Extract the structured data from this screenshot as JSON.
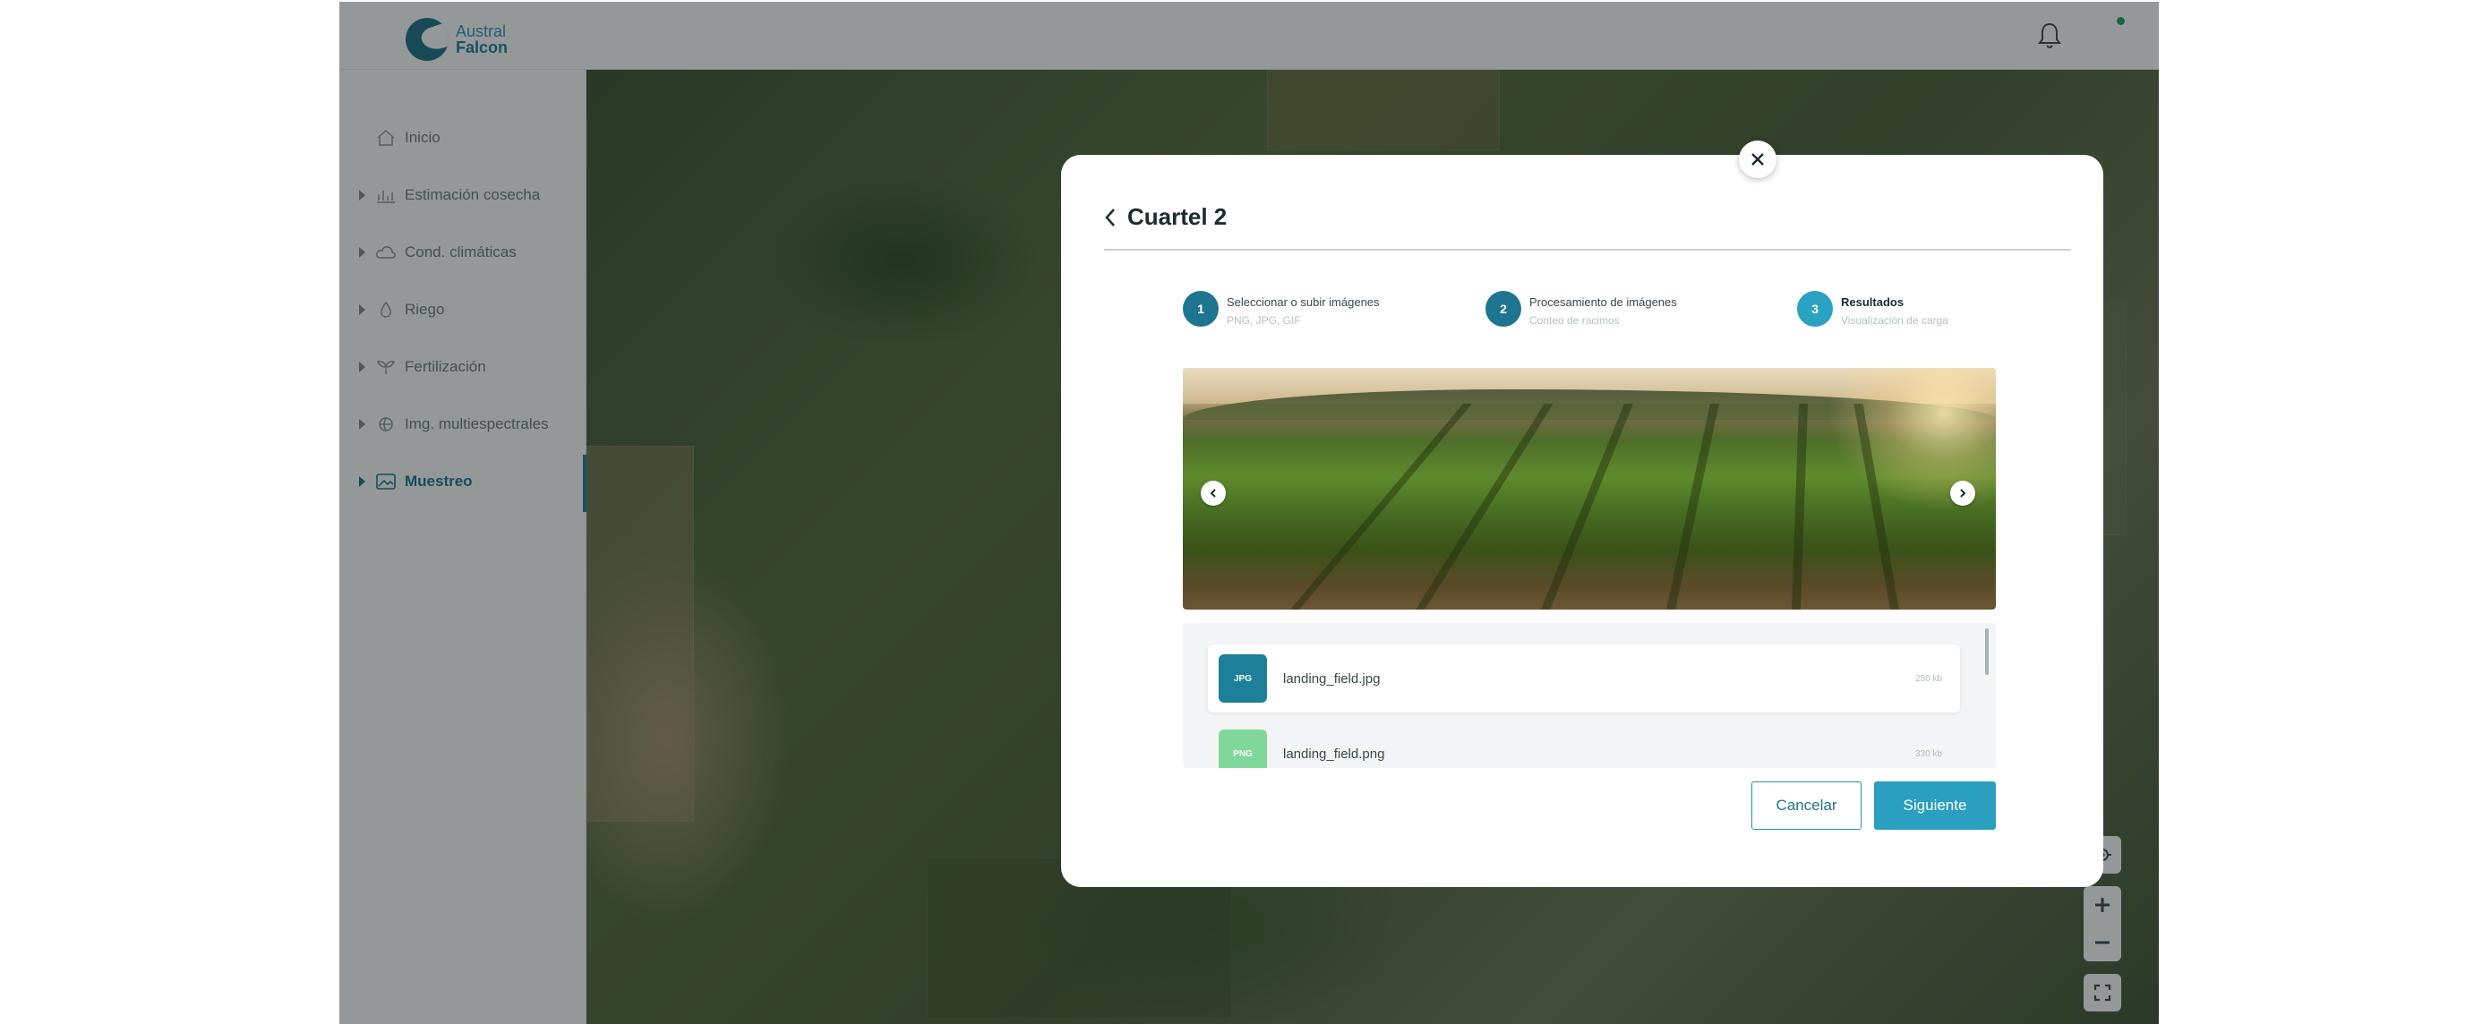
{
  "brand": {
    "line1": "Austral",
    "line2": "Falcon"
  },
  "header": {
    "notification_icon": "bell-icon",
    "status_color": "#19a463"
  },
  "sidebar": {
    "items": [
      {
        "label": "Inicio",
        "icon": "home-icon",
        "expandable": false
      },
      {
        "label": "Estimación cosecha",
        "icon": "harvest-chart-icon",
        "expandable": true
      },
      {
        "label": "Cond. climáticas",
        "icon": "cloud-icon",
        "expandable": true
      },
      {
        "label": "Riego",
        "icon": "water-drop-icon",
        "expandable": true
      },
      {
        "label": "Fertilización",
        "icon": "plant-icon",
        "expandable": true
      },
      {
        "label": "Img. multiespectrales",
        "icon": "layers-icon",
        "expandable": true
      },
      {
        "label": "Muestreo",
        "icon": "image-sample-icon",
        "expandable": true,
        "active": true
      }
    ]
  },
  "map_controls": [
    "locate-icon",
    "zoom-in-icon",
    "zoom-out-icon",
    "fullscreen-icon"
  ],
  "modal": {
    "title": "Cuartel 2",
    "steps": [
      {
        "number": "1",
        "title": "Seleccionar o subir imágenes",
        "subtitle": "PNG, JPG, GIF"
      },
      {
        "number": "2",
        "title": "Procesamiento de imágenes",
        "subtitle": "Conteo de racimos"
      },
      {
        "number": "3",
        "title": "Resultados",
        "subtitle": "Visualización de carga",
        "current": true
      }
    ],
    "files": [
      {
        "type": "JPG",
        "name": "landing_field.jpg",
        "size": "250 kb",
        "color": "#1d7f98",
        "selected": true
      },
      {
        "type": "PNG",
        "name": "landing_field.png",
        "size": "330 kb",
        "color": "#7fd79a",
        "selected": false
      }
    ],
    "buttons": {
      "cancel": "Cancelar",
      "next": "Siguiente"
    }
  },
  "colors": {
    "primary": "#1d7590",
    "accent": "#2a9fc0",
    "overlay": "rgba(20,26,28,0.45)"
  }
}
